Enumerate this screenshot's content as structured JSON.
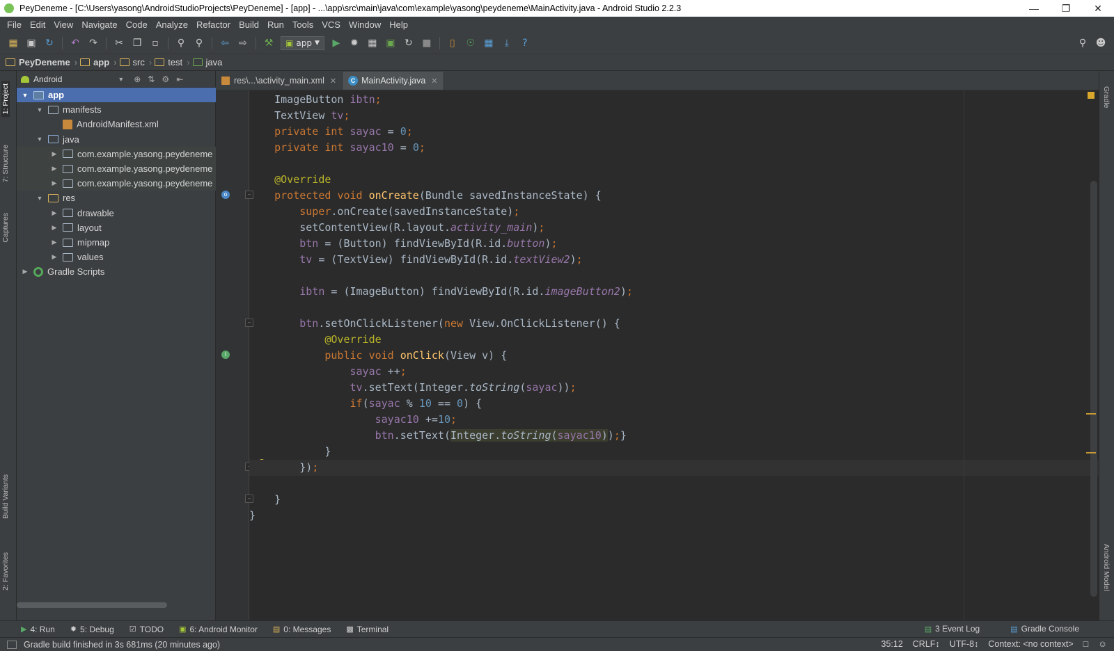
{
  "window": {
    "title": "PeyDeneme - [C:\\Users\\yasong\\AndroidStudioProjects\\PeyDeneme] - [app] - ...\\app\\src\\main\\java\\com\\example\\yasong\\peydeneme\\MainActivity.java - Android Studio 2.2.3"
  },
  "menu": [
    "File",
    "Edit",
    "View",
    "Navigate",
    "Code",
    "Analyze",
    "Refactor",
    "Build",
    "Run",
    "Tools",
    "VCS",
    "Window",
    "Help"
  ],
  "toolbar": {
    "run_config": "app"
  },
  "breadcrumb": [
    "PeyDeneme",
    "app",
    "src",
    "test",
    "java"
  ],
  "left_tool_windows": [
    "1: Project",
    "7: Structure",
    "Captures",
    "Build Variants",
    "2: Favorites"
  ],
  "right_tool_windows": [
    "Gradle",
    "Android Model"
  ],
  "project_panel": {
    "view_mode": "Android",
    "tree": [
      {
        "label": "app",
        "depth": 0,
        "expanded": true,
        "icon": "module-folder-icon",
        "selected": true
      },
      {
        "label": "manifests",
        "depth": 1,
        "expanded": true,
        "icon": "folder-icon"
      },
      {
        "label": "AndroidManifest.xml",
        "depth": 2,
        "icon": "xml-file-icon"
      },
      {
        "label": "java",
        "depth": 1,
        "expanded": true,
        "icon": "source-folder-icon"
      },
      {
        "label": "com.example.yasong.peydeneme",
        "depth": 2,
        "expanded": false,
        "icon": "package-icon"
      },
      {
        "label": "com.example.yasong.peydeneme",
        "depth": 2,
        "expanded": false,
        "icon": "package-icon"
      },
      {
        "label": "com.example.yasong.peydeneme",
        "depth": 2,
        "expanded": false,
        "icon": "package-icon"
      },
      {
        "label": "res",
        "depth": 1,
        "expanded": true,
        "icon": "resource-folder-icon"
      },
      {
        "label": "drawable",
        "depth": 2,
        "expanded": false,
        "icon": "folder-icon"
      },
      {
        "label": "layout",
        "depth": 2,
        "expanded": false,
        "icon": "folder-icon"
      },
      {
        "label": "mipmap",
        "depth": 2,
        "expanded": false,
        "icon": "folder-icon"
      },
      {
        "label": "values",
        "depth": 2,
        "expanded": false,
        "icon": "folder-icon"
      },
      {
        "label": "Gradle Scripts",
        "depth": 0,
        "expanded": false,
        "icon": "gradle-icon"
      }
    ]
  },
  "editor_tabs": [
    {
      "label": "res\\...\\activity_main.xml",
      "active": false
    },
    {
      "label": "MainActivity.java",
      "active": true
    }
  ],
  "code": {
    "current_line": 24,
    "lines": [
      "    ImageButton ibtn;",
      "    TextView tv;",
      "    private int sayac = 0;",
      "    private int sayac10 = 0;",
      "",
      "    @Override",
      "    protected void onCreate(Bundle savedInstanceState) {",
      "        super.onCreate(savedInstanceState);",
      "        setContentView(R.layout.activity_main);",
      "        btn = (Button) findViewById(R.id.button);",
      "        tv = (TextView) findViewById(R.id.textView2);",
      "",
      "        ibtn = (ImageButton) findViewById(R.id.imageButton2);",
      "",
      "        btn.setOnClickListener(new View.OnClickListener() {",
      "            @Override",
      "            public void onClick(View v) {",
      "                sayac ++;",
      "                tv.setText(Integer.toString(sayac));",
      "                if(sayac % 10 == 0) {",
      "                    sayac10 +=10;",
      "                    btn.setText(Integer.toString(sayac10));}",
      "            }",
      "        });",
      "",
      "    }",
      "}"
    ]
  },
  "bottom_tabs": [
    {
      "label": "4: Run",
      "icon": "run-icon"
    },
    {
      "label": "5: Debug",
      "icon": "debug-icon"
    },
    {
      "label": "TODO",
      "icon": "todo-icon"
    },
    {
      "label": "6: Android Monitor",
      "icon": "android-icon"
    },
    {
      "label": "0: Messages",
      "icon": "messages-icon"
    },
    {
      "label": "Terminal",
      "icon": "terminal-icon"
    }
  ],
  "bottom_right_tabs": [
    {
      "label": "3 Event Log",
      "icon": "event-log-icon"
    },
    {
      "label": "Gradle Console",
      "icon": "gradle-console-icon"
    }
  ],
  "status": {
    "message": "Gradle build finished in 3s 681ms (20 minutes ago)",
    "position": "35:12",
    "line_separator": "CRLF↕",
    "encoding": "UTF-8↕",
    "context": "Context: <no context>"
  }
}
